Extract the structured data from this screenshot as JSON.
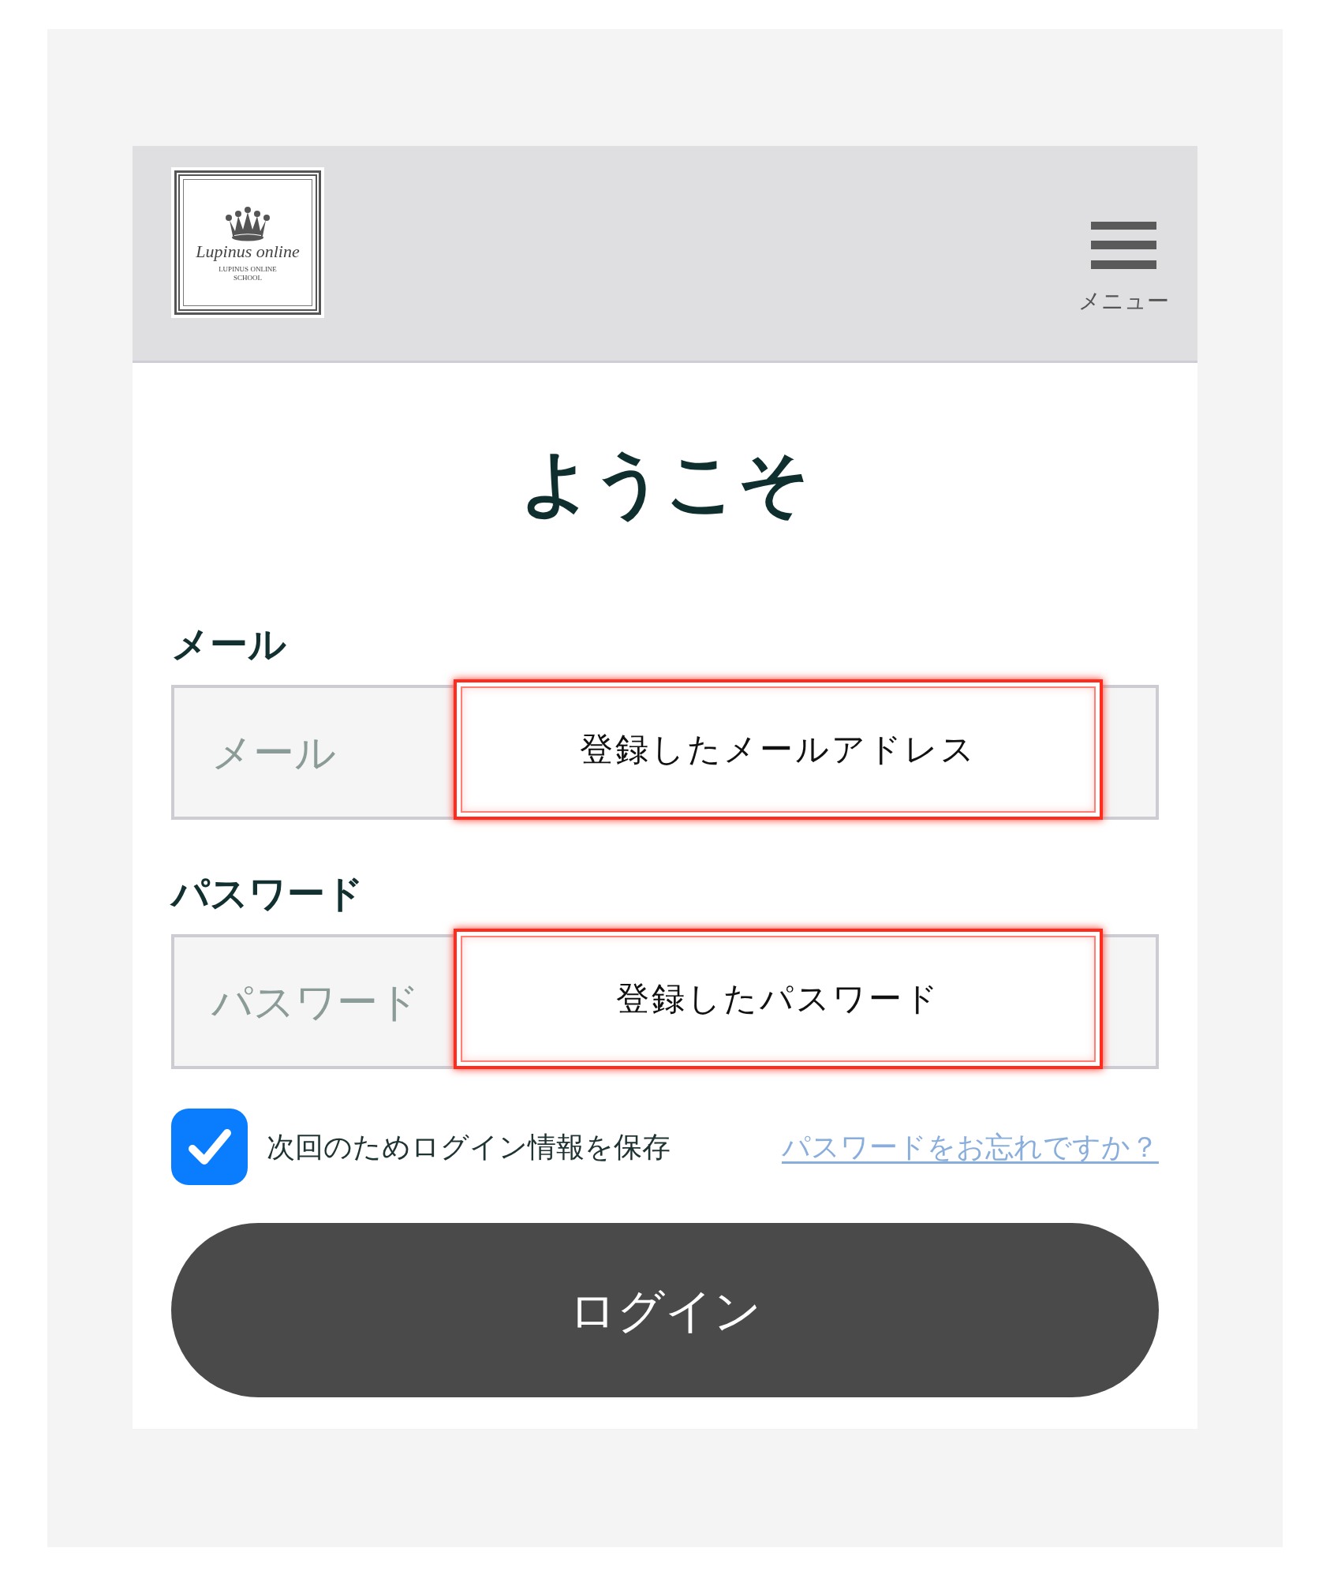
{
  "header": {
    "logo": {
      "script": "Lupinus online",
      "subtitle": "LUPINUS ONLINE SCHOOL"
    },
    "menu": {
      "label": "メニュー"
    }
  },
  "title": "ようこそ",
  "fields": [
    {
      "label": "メール",
      "placeholder": "メール",
      "annotation": "登録したメールアドレス"
    },
    {
      "label": "パスワード",
      "placeholder": "パスワード",
      "annotation": "登録したパスワード"
    }
  ],
  "remember": {
    "label": "次回のためログイン情報を保存",
    "checked": true
  },
  "forgot_link": "パスワードをお忘れですか？",
  "login_button": "ログイン"
}
